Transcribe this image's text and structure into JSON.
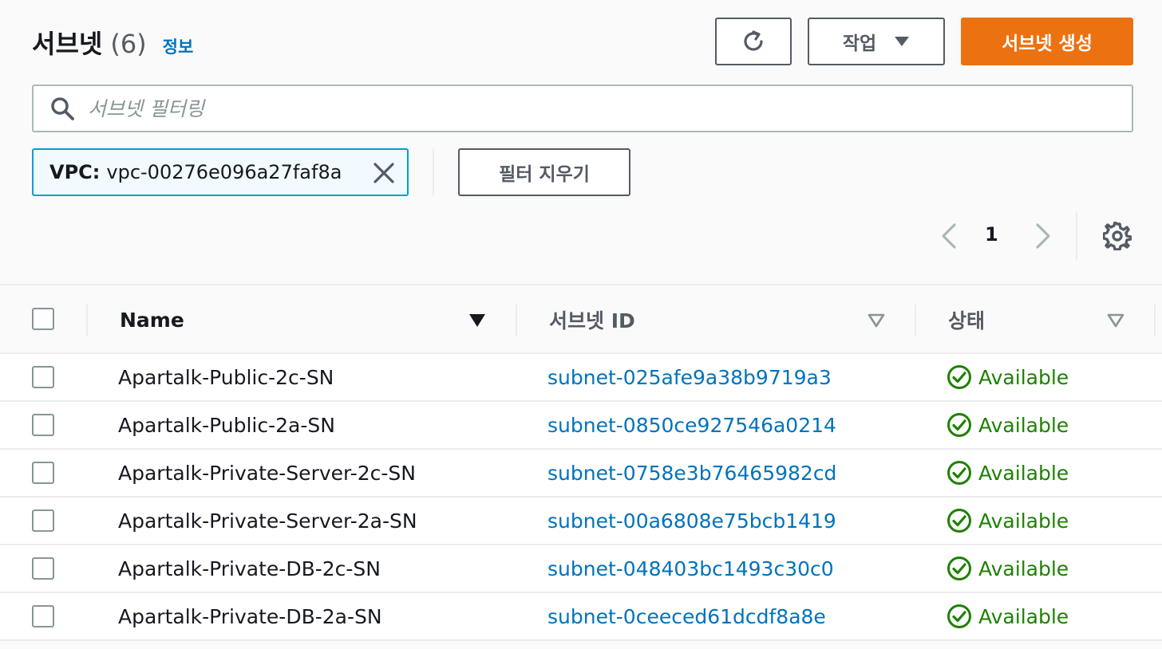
{
  "header": {
    "title": "서브넷",
    "count": "(6)",
    "info_link": "정보",
    "actions_label": "작업",
    "create_label": "서브넷 생성"
  },
  "search": {
    "placeholder": "서브넷 필터링"
  },
  "filter": {
    "key": "VPC:",
    "value": "vpc-00276e096a27faf8a",
    "clear_label": "필터 지우기"
  },
  "pagination": {
    "current_page": "1"
  },
  "table": {
    "columns": [
      "Name",
      "서브넷 ID",
      "상태"
    ],
    "rows": [
      {
        "name": "Apartalk-Public-2c-SN",
        "subnet_id": "subnet-025afe9a38b9719a3",
        "status": "Available"
      },
      {
        "name": "Apartalk-Public-2a-SN",
        "subnet_id": "subnet-0850ce927546a0214",
        "status": "Available"
      },
      {
        "name": "Apartalk-Private-Server-2c-SN",
        "subnet_id": "subnet-0758e3b76465982cd",
        "status": "Available"
      },
      {
        "name": "Apartalk-Private-Server-2a-SN",
        "subnet_id": "subnet-00a6808e75bcb1419",
        "status": "Available"
      },
      {
        "name": "Apartalk-Private-DB-2c-SN",
        "subnet_id": "subnet-048403bc1493c30c0",
        "status": "Available"
      },
      {
        "name": "Apartalk-Private-DB-2a-SN",
        "subnet_id": "subnet-0ceeced61dcdf8a8e",
        "status": "Available"
      }
    ]
  },
  "icons": {
    "refresh": "refresh-icon",
    "dropdown": "caret-down-icon",
    "search": "search-icon",
    "close": "close-icon",
    "prev": "chevron-left-icon",
    "next": "chevron-right-icon",
    "settings": "gear-icon",
    "status": "check-circle-icon"
  },
  "colors": {
    "primary": "#ec7211",
    "link": "#0073bb",
    "success": "#1d8102",
    "token_border": "#00a1c9"
  }
}
